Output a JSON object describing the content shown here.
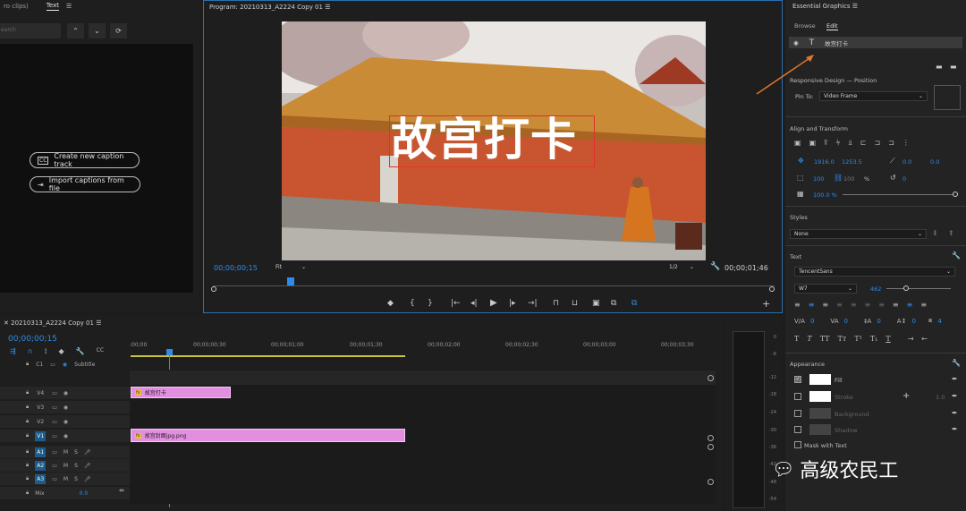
{
  "left_panel": {
    "tab_no_clips": "ro clips)",
    "tab_text": "Text",
    "search_placeholder": "earch",
    "create_caption_track": "Create new caption track",
    "import_captions": "Import captions from file"
  },
  "program": {
    "title": "Program: 20210313_A2224 Copy 01",
    "overlay_text": "故宫打卡",
    "current_time": "00;00;00;15",
    "fit": "Fit",
    "resolution": "1/2",
    "duration": "00;00;01;46"
  },
  "timeline": {
    "sequence_name": "20210313_A2224 Copy 01",
    "timecode": "00;00;00;15",
    "ruler": [
      ":00;00",
      "00;00;00;30",
      "00;00;01;00",
      "00;00;01;30",
      "00;00;02;00",
      "00;00;02;30",
      "00;00;03;00",
      "00;00;03;30"
    ],
    "subtitle_label": "Subtitle",
    "c1": "C1",
    "tracks": [
      {
        "name": "V4",
        "type": "video"
      },
      {
        "name": "V3",
        "type": "video"
      },
      {
        "name": "V2",
        "type": "video"
      },
      {
        "name": "V1",
        "type": "video"
      },
      {
        "name": "A1",
        "type": "audio"
      },
      {
        "name": "A2",
        "type": "audio"
      },
      {
        "name": "A3",
        "type": "audio"
      }
    ],
    "mix_label": "Mix",
    "mix_value": "0.0",
    "clips": {
      "v4_clip": "故宫打卡",
      "v1_clip": "故宫封面jpg.png"
    },
    "meter_scale": [
      "0",
      "-6",
      "-12",
      "-18",
      "-24",
      "-30",
      "-36",
      "-42",
      "-48",
      "-54"
    ]
  },
  "essential_graphics": {
    "title": "Essential Graphics",
    "tab_browse": "Browse",
    "tab_edit": "Edit",
    "layer_name": "故宫打卡",
    "responsive_design": "Responsive Design — Position",
    "pin_to_label": "Pin To:",
    "pin_to_value": "Video Frame",
    "align_transform": "Align and Transform",
    "pos_x": "1916.0",
    "pos_y": "1253.5",
    "rotation": "0.0",
    "rotation2": "0.0",
    "scale_w": "100",
    "scale_h": "100",
    "scale_unit": "%",
    "anchor_rot": "0",
    "opacity": "100.0 %",
    "styles": "Styles",
    "style_value": "None",
    "text_section": "Text",
    "font_name": "TencentSans",
    "font_weight": "W7",
    "font_size": "462",
    "kerning": "0",
    "tracking": "0",
    "leading": "0",
    "baseline": "0",
    "tsume": "4",
    "appearance": "Appearance",
    "fill": "Fill",
    "stroke": "Stroke",
    "stroke_width": "1.0",
    "background": "Background",
    "shadow": "Shadow",
    "mask_with_text": "Mask with Text"
  },
  "watermark": {
    "text": "高级农民工"
  },
  "colors": {
    "accent": "#2d8ceb",
    "clip_pink": "#e28fe0",
    "arrow": "#e0772a"
  }
}
